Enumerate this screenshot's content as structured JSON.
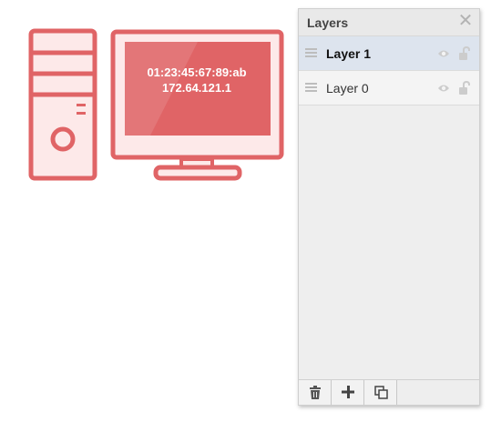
{
  "device": {
    "mac_address": "01:23:45:67:89:ab",
    "ip_address": "172.64.121.1",
    "color": "#e06466"
  },
  "layers_panel": {
    "title": "Layers",
    "close_icon": "close-icon",
    "layers": [
      {
        "name": "Layer 1",
        "selected": true
      },
      {
        "name": "Layer 0",
        "selected": false
      }
    ],
    "footer_buttons": [
      "delete-layer-icon",
      "add-layer-icon",
      "duplicate-layer-icon"
    ]
  }
}
